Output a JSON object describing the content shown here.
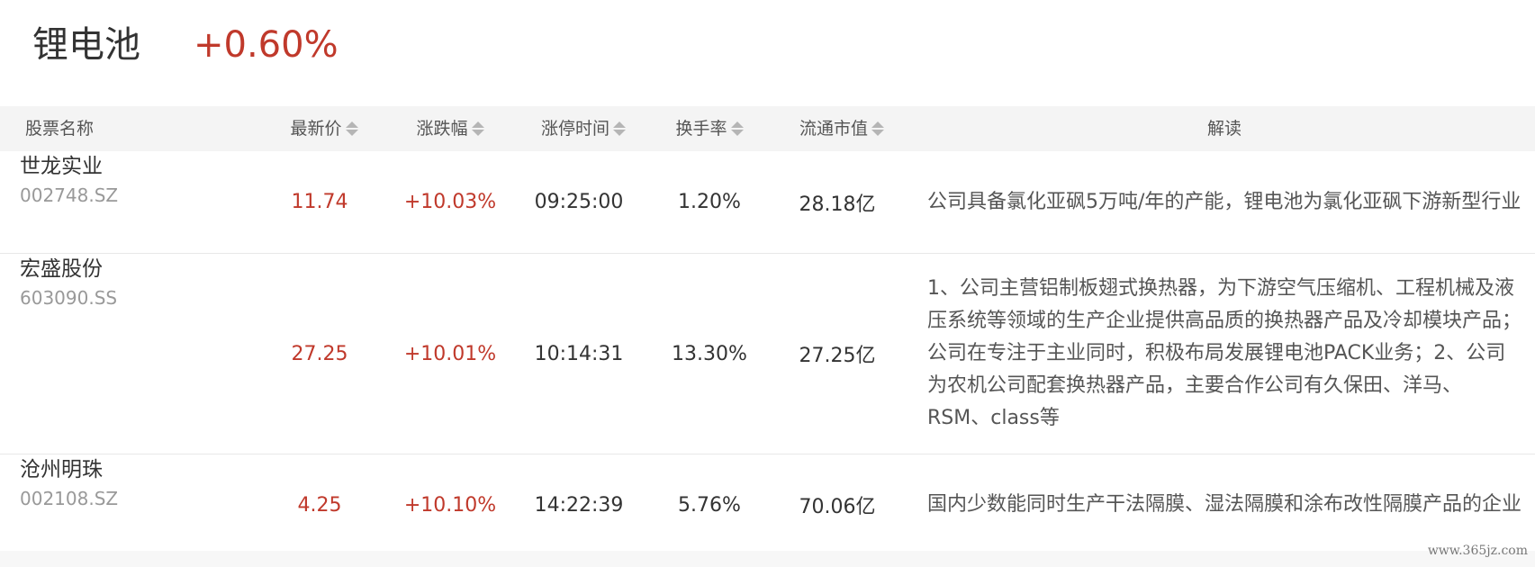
{
  "sector": {
    "name": "锂电池",
    "change": "+0.60%"
  },
  "table": {
    "headers": {
      "name": "股票名称",
      "price": "最新价",
      "change": "涨跌幅",
      "limit_time": "涨停时间",
      "turnover": "换手率",
      "market_cap": "流通市值",
      "interpretation": "解读"
    },
    "rows": [
      {
        "name": "世龙实业",
        "code": "002748.SZ",
        "price": "11.74",
        "change": "+10.03%",
        "limit_time": "09:25:00",
        "turnover": "1.20%",
        "market_cap": "28.18亿",
        "interpretation": "公司具备氯化亚砜5万吨/年的产能，锂电池为氯化亚砜下游新型行业"
      },
      {
        "name": "宏盛股份",
        "code": "603090.SS",
        "price": "27.25",
        "change": "+10.01%",
        "limit_time": "10:14:31",
        "turnover": "13.30%",
        "market_cap": "27.25亿",
        "interpretation": "1、公司主营铝制板翅式换热器，为下游空气压缩机、工程机械及液压系统等领域的生产企业提供高品质的换热器产品及冷却模块产品；公司在专注于主业同时，积极布局发展锂电池PACK业务；2、公司为农机公司配套换热器产品，主要合作公司有久保田、洋马、RSM、class等"
      },
      {
        "name": "沧州明珠",
        "code": "002108.SZ",
        "price": "4.25",
        "change": "+10.10%",
        "limit_time": "14:22:39",
        "turnover": "5.76%",
        "market_cap": "70.06亿",
        "interpretation": "国内少数能同时生产干法隔膜、湿法隔膜和涂布改性隔膜产品的企业"
      }
    ]
  },
  "watermark": "www.365jz.com",
  "colors": {
    "up": "#c0392b",
    "header_bg": "#f4f4f4",
    "text": "#333333",
    "muted": "#999999"
  },
  "icons": {
    "sort": "sort-arrows-icon"
  }
}
